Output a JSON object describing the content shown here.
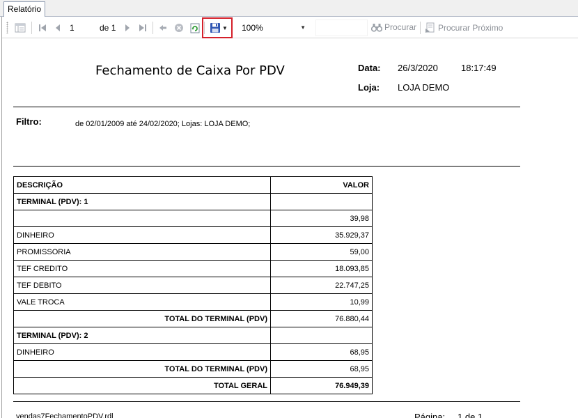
{
  "tab": {
    "label": "Relatório"
  },
  "toolbar": {
    "page_value": "1",
    "page_of_label": "de",
    "page_total": "1",
    "zoom": "100%",
    "find_label": "Procurar",
    "find_next_label": "Procurar Próximo",
    "icons": [
      "document-map-icon",
      "first-page-icon",
      "prev-page-icon",
      "next-page-icon",
      "last-page-icon",
      "back-icon",
      "stop-icon",
      "refresh-icon",
      "save-icon",
      "dropdown-arrow-icon",
      "binoculars-icon",
      "find-next-icon"
    ],
    "highlight_color": "#d4202a"
  },
  "report": {
    "title": "Fechamento de Caixa Por PDV",
    "data_label": "Data:",
    "data_value": "26/3/2020",
    "time_value": "18:17:49",
    "loja_label": "Loja:",
    "loja_value": "LOJA DEMO",
    "filtro_label": "Filtro:",
    "filtro_value": "de 02/01/2009 até 24/02/2020; Lojas: LOJA DEMO;",
    "table": {
      "header_desc": "DESCRIÇÃO",
      "header_val": "VALOR",
      "rows": [
        {
          "desc": "TERMINAL (PDV): 1",
          "val": ""
        },
        {
          "desc": "",
          "val": "39,98"
        },
        {
          "desc": "DINHEIRO",
          "val": "35.929,37"
        },
        {
          "desc": "PROMISSORIA",
          "val": "59,00"
        },
        {
          "desc": "TEF CREDITO",
          "val": "18.093,85"
        },
        {
          "desc": "TEF DEBITO",
          "val": "22.747,25"
        },
        {
          "desc": "VALE TROCA",
          "val": "10,99"
        },
        {
          "desc": "TOTAL DO TERMINAL (PDV)",
          "val": "76.880,44"
        },
        {
          "desc": "TERMINAL (PDV): 2",
          "val": ""
        },
        {
          "desc": "DINHEIRO",
          "val": "68,95"
        },
        {
          "desc": "TOTAL DO TERMINAL (PDV)",
          "val": "68,95"
        },
        {
          "desc": "TOTAL GERAL",
          "val": "76.949,39"
        }
      ]
    },
    "footer_file": "vendas7FechamentoPDV.rdl",
    "footer_page_label": "Página:",
    "footer_page_value": "1 de 1"
  }
}
